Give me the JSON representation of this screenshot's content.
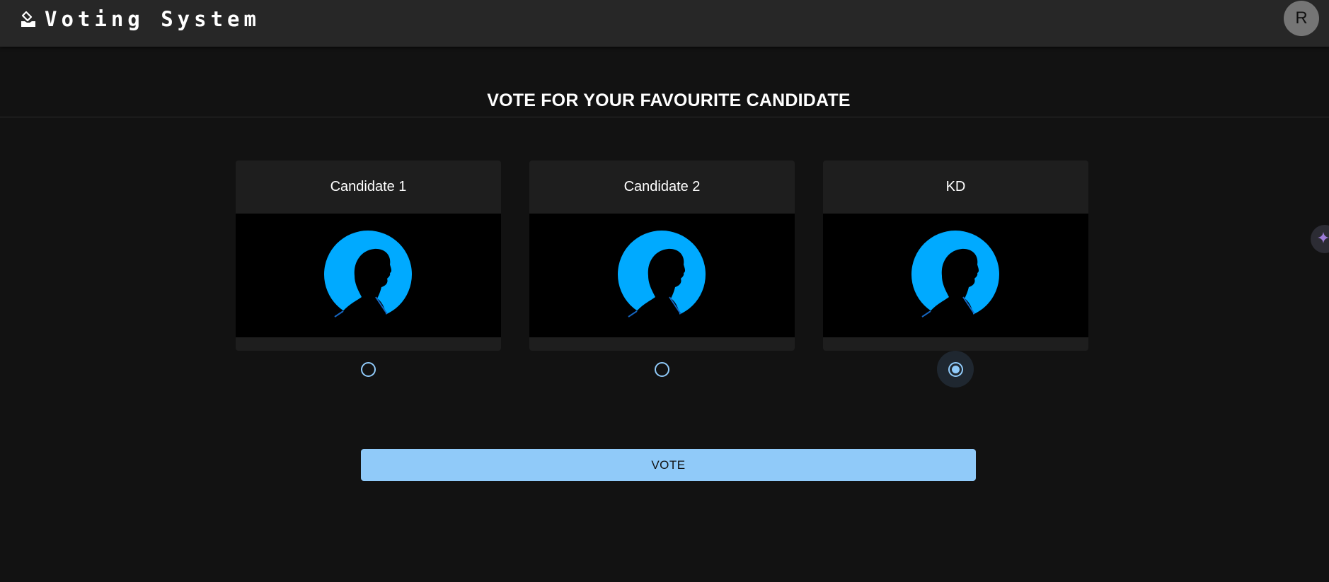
{
  "app": {
    "title": "Voting System",
    "logo_icon": "ballot-box-icon",
    "avatar_letter": "R"
  },
  "page": {
    "heading": "VOTE FOR YOUR FAVOURITE CANDIDATE"
  },
  "candidates": [
    {
      "name": "Candidate 1",
      "image_icon": "person-silhouette-icon",
      "selected": false
    },
    {
      "name": "Candidate 2",
      "image_icon": "person-silhouette-icon",
      "selected": false
    },
    {
      "name": "KD",
      "image_icon": "person-silhouette-icon",
      "selected": true
    }
  ],
  "actions": {
    "vote_label": "VOTE"
  },
  "side": {
    "icon": "sparkle-icon"
  },
  "colors": {
    "background": "#121212",
    "appbar": "#272727",
    "card": "#1e1e1e",
    "accent": "#90caf9",
    "silhouette_circle": "#00aaff"
  }
}
